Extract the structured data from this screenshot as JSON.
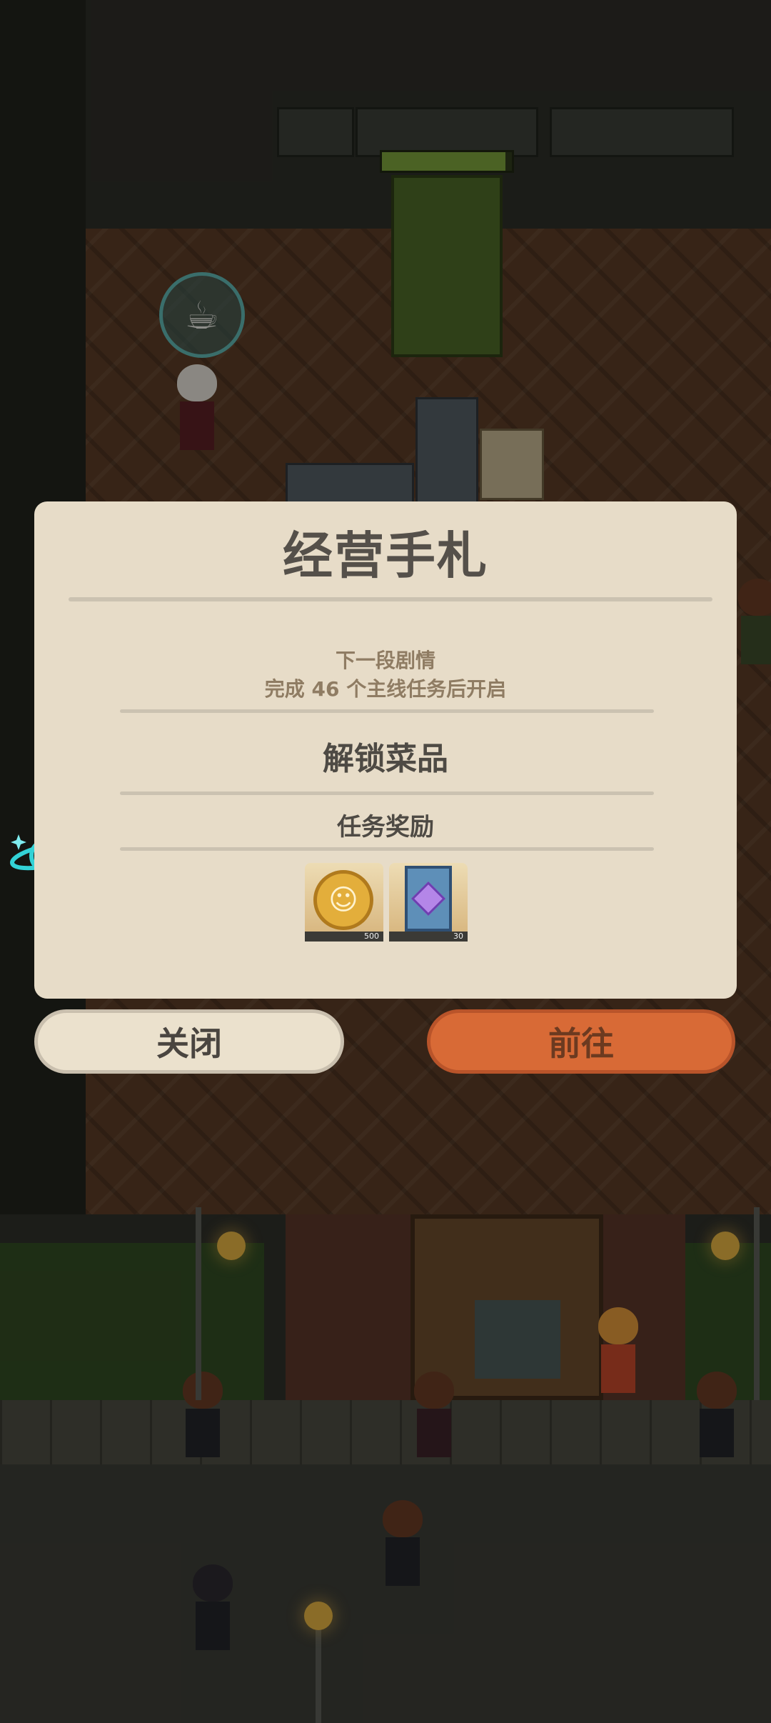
{
  "dialog": {
    "title": "经营手札",
    "next_story_label": "下一段剧情",
    "next_story_requirement": "完成 46 个主线任务后开启",
    "unlock_section": "解锁菜品",
    "reward_section": "任务奖励",
    "rewards": [
      {
        "icon": "gold-coin-icon",
        "count": "500"
      },
      {
        "icon": "purple-gem-ticket-icon",
        "count": "30"
      }
    ]
  },
  "buttons": {
    "close": "关闭",
    "go": "前往"
  },
  "scene": {
    "bubble_icon": "coffee-cup-icon",
    "floating_icon": "orbit-planet-icon",
    "progress_fill": 0.95
  },
  "colors": {
    "dialog_bg": "#e7dcc8",
    "title_text": "#55504a",
    "sub_text": "#8f7c63",
    "primary_button": "#d86a36",
    "secondary_button": "#ebe1cd"
  }
}
